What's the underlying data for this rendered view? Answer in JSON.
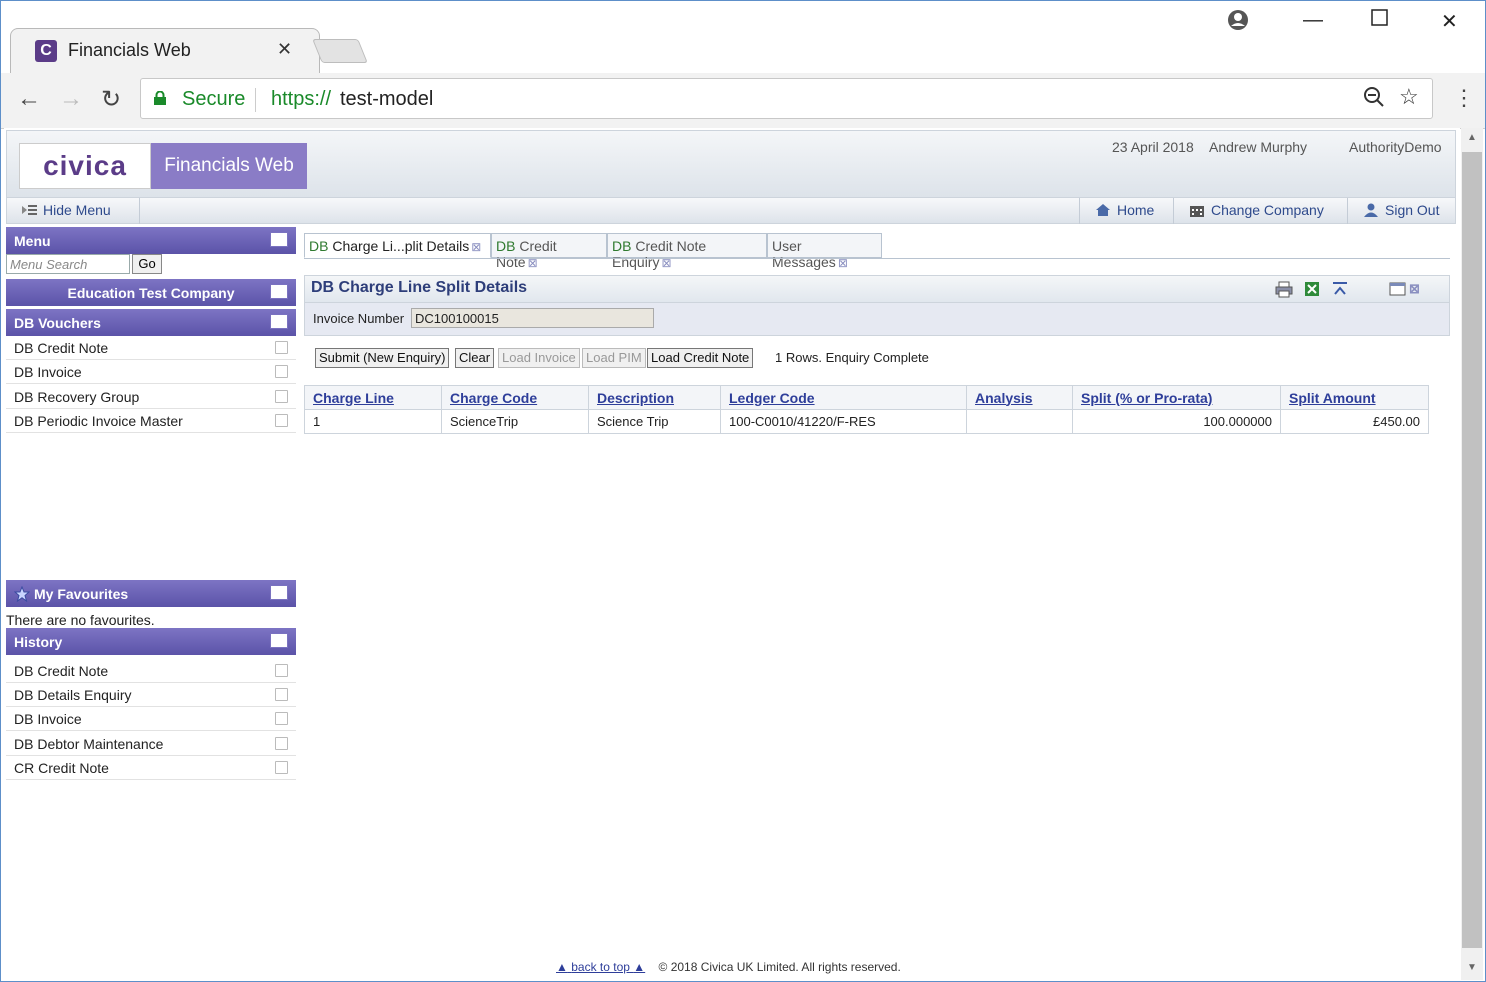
{
  "browser": {
    "tab_title": "Financials Web",
    "tab_favicon": "C",
    "secure_label": "Secure",
    "url_protocol": "https://",
    "url_host": "test-model"
  },
  "app": {
    "logo_text": "civica",
    "product_name": "Financials Web",
    "date": "23 April 2018",
    "user": "Andrew Murphy",
    "authority": "AuthorityDemo",
    "nav": {
      "hide_menu": "Hide Menu",
      "home": "Home",
      "change_company": "Change Company",
      "sign_out": "Sign Out"
    }
  },
  "sidebar": {
    "menu_title": "Menu",
    "search_placeholder": "Menu Search",
    "go_label": "Go",
    "company": "Education Test Company",
    "vouchers_title": "DB Vouchers",
    "vouchers": [
      "DB Credit Note",
      "DB Invoice",
      "DB Recovery Group",
      "DB Periodic Invoice Master"
    ],
    "favourites_title": "My Favourites",
    "favourites_empty": "There are no favourites.",
    "history_title": "History",
    "history": [
      "DB Credit Note",
      "DB Details Enquiry",
      "DB Invoice",
      "DB Debtor Maintenance",
      "CR Credit Note"
    ]
  },
  "tabs": [
    {
      "prefix": "DB",
      "label": " Charge Li...plit Details"
    },
    {
      "prefix": "DB",
      "label": " Credit Note"
    },
    {
      "prefix": "DB",
      "label": " Credit Note Enquiry"
    },
    {
      "prefix": "",
      "label": "User Messages"
    }
  ],
  "panel": {
    "title": "DB Charge Line Split Details",
    "invoice_label": "Invoice Number",
    "invoice_value": "DC100100015"
  },
  "buttons": {
    "submit": "Submit (New Enquiry)",
    "clear": "Clear",
    "load_invoice": "Load Invoice",
    "load_pim": "Load PIM",
    "load_credit_note": "Load Credit Note",
    "status": "1 Rows. Enquiry Complete"
  },
  "table": {
    "headers": [
      "Charge Line",
      "Charge Code",
      "Description",
      "Ledger Code",
      "Analysis",
      "Split (% or Pro-rata)",
      "Split Amount"
    ],
    "rows": [
      [
        "1",
        "ScienceTrip",
        "Science Trip",
        "100-C0010/41220/F-RES",
        "",
        "100.000000",
        "£450.00"
      ]
    ]
  },
  "footer": {
    "back_to_top": "back to top",
    "copyright": "© 2018 Civica UK Limited. All rights reserved."
  },
  "colors": {
    "brand_purple": "#5b3c88",
    "header_purple": "#6a62b6",
    "link_blue": "#2e3e9a",
    "secure_green": "#1a8a2a"
  }
}
